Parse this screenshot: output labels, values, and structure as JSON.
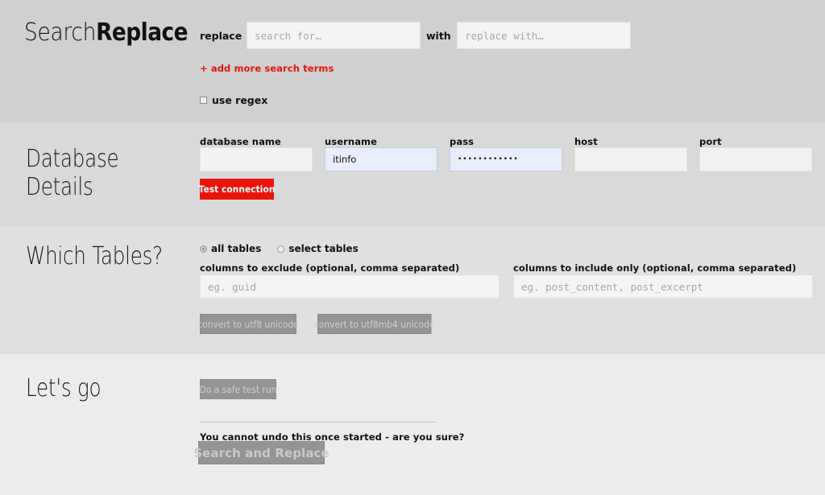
{
  "app": {
    "logo_light": "Search",
    "logo_bold": "Replace"
  },
  "colors": {
    "accent_red": "#e8140c",
    "section_search_bg": "#d0d0d0",
    "section_db_bg": "#d9d9d9",
    "section_tables_bg": "#e0e0e0",
    "section_go_bg": "#ececec",
    "button_disabled": "#949494",
    "autofill_field": "#e8eefc"
  },
  "search_section": {
    "replace_label": "replace",
    "search_for": {
      "value": "",
      "placeholder": "search for…"
    },
    "with_label": "with",
    "replace_with": {
      "value": "",
      "placeholder": "replace with…"
    },
    "add_more_link": "+ add more search terms",
    "use_regex": {
      "label": "use regex",
      "checked": false
    }
  },
  "database_section": {
    "title": "Database\nDetails",
    "fields": [
      {
        "label": "database name",
        "value": "",
        "placeholder": "",
        "autofilled": false
      },
      {
        "label": "username",
        "value": "itinfo",
        "placeholder": "",
        "autofilled": true
      },
      {
        "label": "pass",
        "value": "••••••••••••",
        "placeholder": "",
        "autofilled": true
      },
      {
        "label": "host",
        "value": "",
        "placeholder": "",
        "autofilled": false
      },
      {
        "label": "port",
        "value": "",
        "placeholder": "",
        "autofilled": false
      }
    ],
    "test_connection_label": "Test connection"
  },
  "tables_section": {
    "title": "Which Tables?",
    "radios": [
      {
        "label": "all tables",
        "selected": true
      },
      {
        "label": "select tables",
        "selected": false
      }
    ],
    "exclude": {
      "label": "columns to exclude (optional, comma separated)",
      "value": "",
      "placeholder": "eg. guid"
    },
    "include": {
      "label": "columns to include only (optional, comma separated)",
      "value": "",
      "placeholder": "eg. post_content, post_excerpt"
    },
    "convert_utf8_label": "convert to utf8 unicode",
    "convert_utf8mb4_label": "convert to utf8mb4 unicode"
  },
  "go_section": {
    "title": "Let's go",
    "dry_run_label": "Do a safe test run",
    "warning": "You cannot undo this once started - are you sure?",
    "submit_label": "Search and Replace"
  }
}
